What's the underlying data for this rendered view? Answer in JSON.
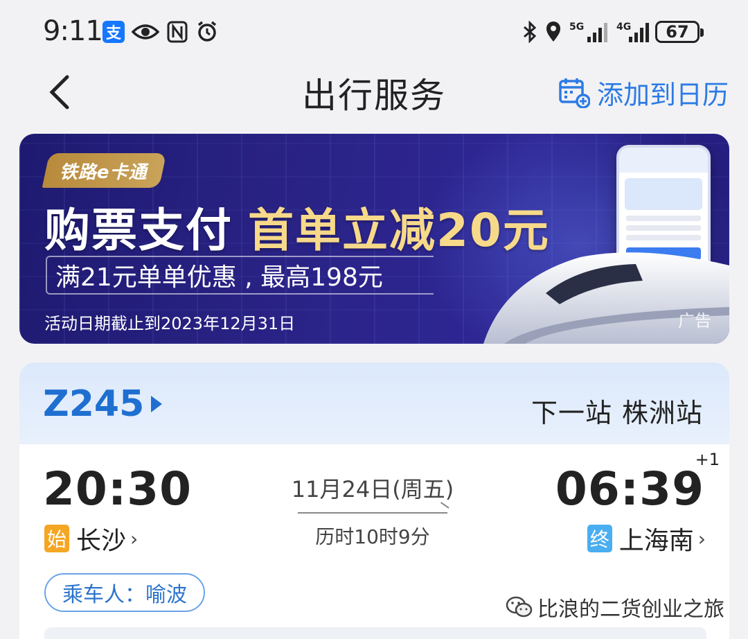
{
  "status_bar": {
    "time": "9:11",
    "battery": "67",
    "network_5g": "5G",
    "network_4g": "4G",
    "icons": [
      "alipay-icon",
      "eye-icon",
      "nfc-icon",
      "alarm-icon",
      "bluetooth-icon",
      "location-icon",
      "signal-5g-icon",
      "signal-4g-icon",
      "battery-icon"
    ]
  },
  "header": {
    "title": "出行服务",
    "add_calendar_label": "添加到日历"
  },
  "banner": {
    "brand": "铁路e卡通",
    "headline_main": "购票支付",
    "headline_highlight": "首单立减20元",
    "subline": "满21元单单优惠 , 最高198元",
    "date_note": "活动日期截止到2023年12月31日",
    "ad_label": "广告"
  },
  "trip": {
    "train_number": "Z245",
    "next_station_label": "下一站",
    "next_station": "株洲站",
    "departure_time": "20:30",
    "arrival_time": "06:39",
    "arrival_day_offset": "+1",
    "date": "11月24日(周五)",
    "duration": "历时10时9分",
    "departure_badge": "始",
    "departure_station": "长沙",
    "arrival_badge": "终",
    "arrival_station": "上海南",
    "station_chevron": "›",
    "passenger": "乘车人：喻波"
  },
  "watermark": "比浪的二货创业之旅",
  "colors": {
    "accent_blue": "#2c7be5",
    "train_blue": "#1f6fd1",
    "start_badge": "#f5a623",
    "end_badge": "#4aaef0",
    "banner_bg": "#2a2386",
    "banner_gold": "#f7d98a"
  }
}
